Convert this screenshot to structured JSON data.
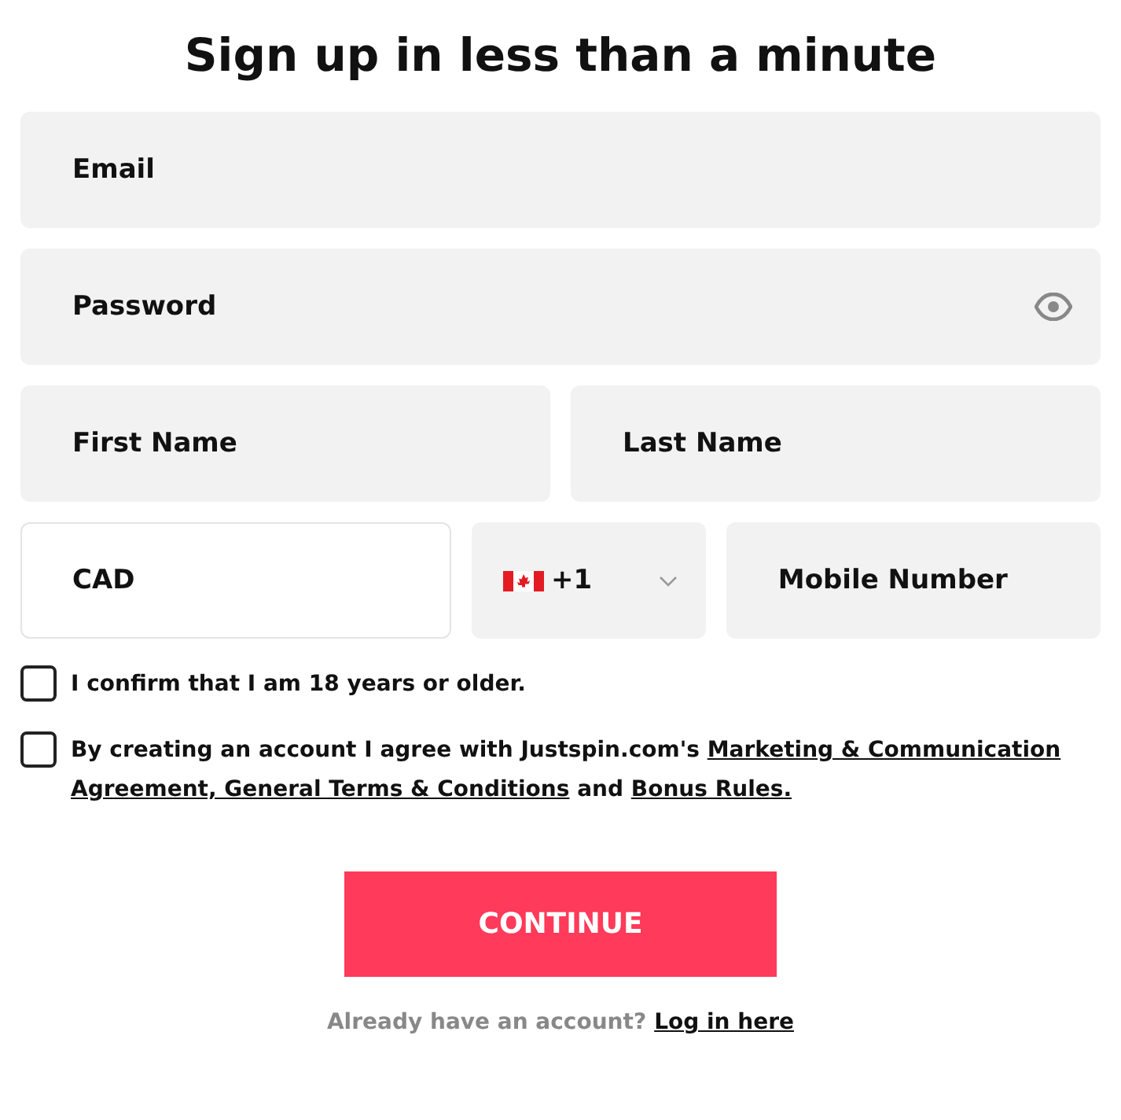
{
  "title": "Sign up in less than a minute",
  "email": {
    "placeholder": "Email"
  },
  "password": {
    "placeholder": "Password"
  },
  "first_name": {
    "placeholder": "First Name"
  },
  "last_name": {
    "placeholder": "Last Name"
  },
  "currency": {
    "value": "CAD"
  },
  "phone_code": {
    "value": "+1"
  },
  "mobile": {
    "placeholder": "Mobile Number"
  },
  "checkboxes": [
    {
      "checked": false,
      "parts": [
        {
          "kind": "text",
          "text": "I confirm that I am 18 years or older."
        }
      ]
    },
    {
      "checked": false,
      "parts": [
        {
          "kind": "text",
          "text": "By creating an account I agree with Justspin.com's"
        },
        {
          "kind": "link",
          "text": "Marketing & Communication"
        },
        {
          "kind": "link",
          "text": "Agreement, General Terms & Conditions"
        },
        {
          "kind": "text",
          "text": "and"
        },
        {
          "kind": "link",
          "text": "Bonus Rules."
        }
      ]
    }
  ],
  "continue_button": "CONTINUE",
  "login_prompt": {
    "text": "Already have an account?",
    "link": "Log in here"
  }
}
